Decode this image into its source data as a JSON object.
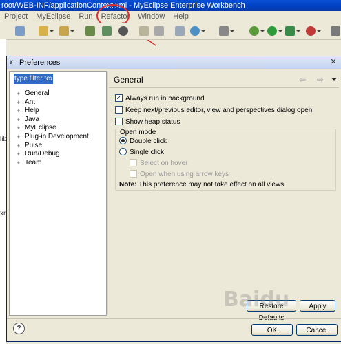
{
  "workbench": {
    "title": "root/WEB-INF/applicationContext.xml - MyEclipse Enterprise Workbench",
    "menus": [
      "Project",
      "MyEclipse",
      "Run",
      "Refactor",
      "Window",
      "Help"
    ],
    "side_texts": [
      "lib",
      "xml"
    ]
  },
  "dialog": {
    "title": "Preferences",
    "filter_placeholder": "type filter text",
    "tree": [
      "General",
      "Ant",
      "Help",
      "Java",
      "MyEclipse",
      "Plug-in Development",
      "Pulse",
      "Run/Debug",
      "Team"
    ],
    "page_title": "General",
    "options": [
      {
        "label": "Always run in background",
        "checked": true
      },
      {
        "label": "Keep next/previous editor, view and perspectives dialog open",
        "checked": false
      },
      {
        "label": "Show heap status",
        "checked": false
      }
    ],
    "open_mode": {
      "label": "Open mode",
      "double_click": "Double click",
      "single_click": "Single click",
      "select_on_hover": "Select on hover",
      "open_arrow_keys": "Open when using arrow keys"
    },
    "note_label": "Note:",
    "note_text": "This preference may not take effect on all views",
    "buttons": {
      "restore": "Restore Defaults",
      "apply": "Apply",
      "ok": "OK",
      "cancel": "Cancel"
    },
    "help_glyph": "?"
  },
  "colors": {
    "annotation": "#e03030",
    "titlebar": "#0040c0",
    "selection": "#316ac5"
  },
  "watermark": "Baidu"
}
